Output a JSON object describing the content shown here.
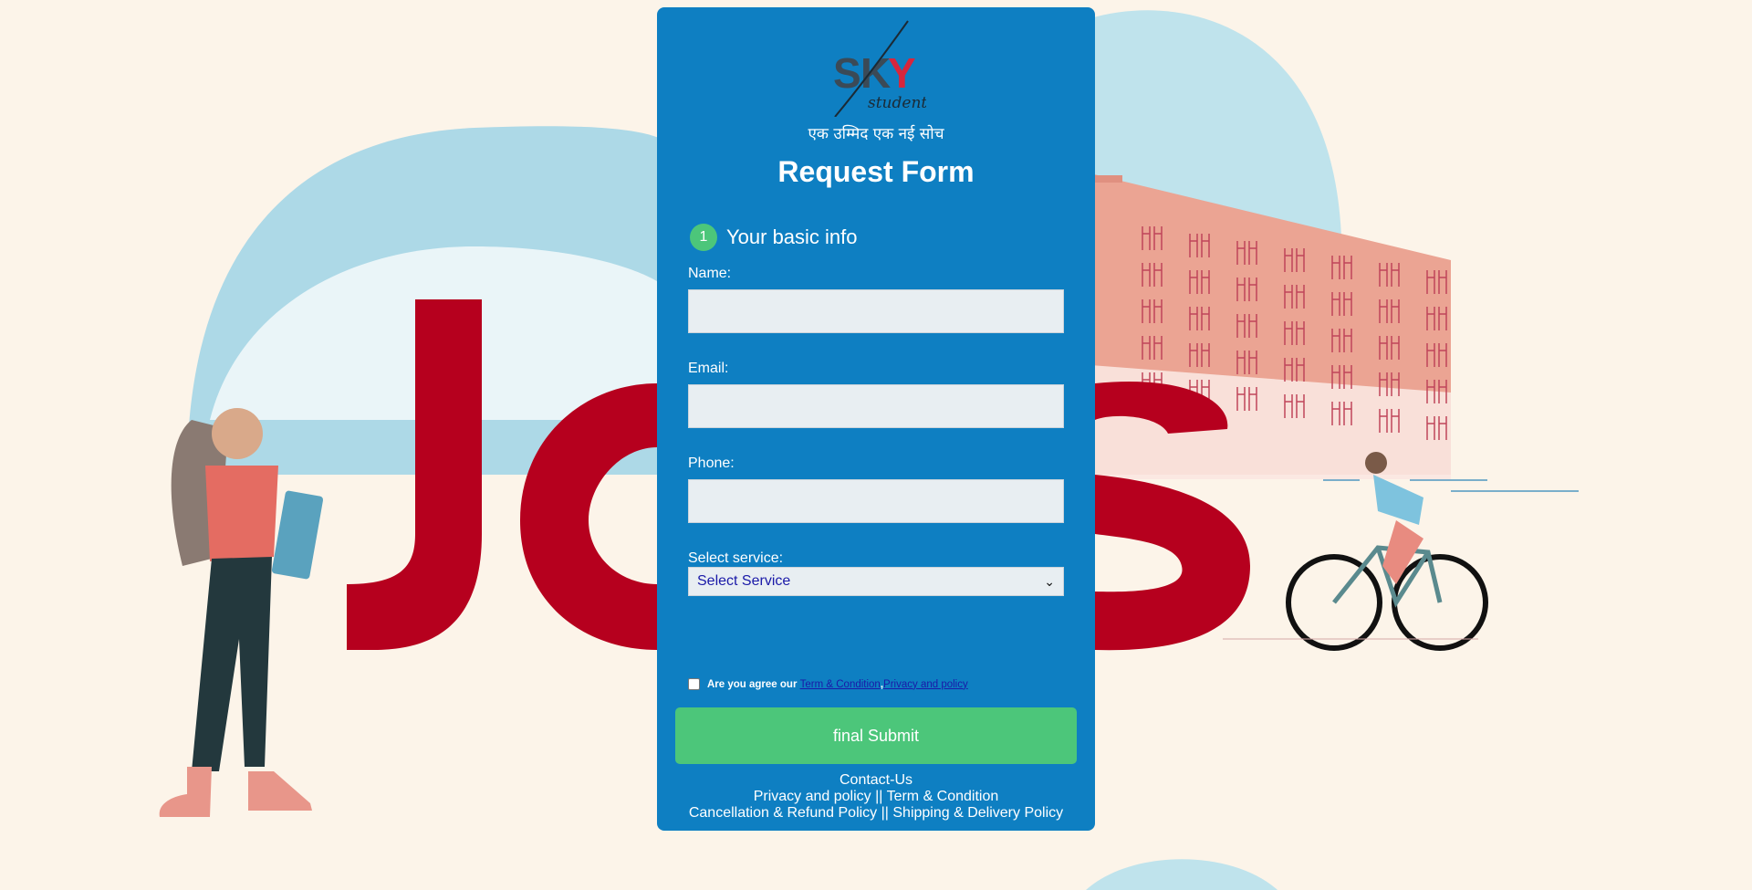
{
  "brand": {
    "tagline": "एक उम्मिद एक नई सोच"
  },
  "form": {
    "title": "Request Form",
    "step_number": "1",
    "step_label": "Your basic info",
    "fields": [
      {
        "label": "Name:",
        "value": "",
        "placeholder": ""
      },
      {
        "label": "Email:",
        "value": "",
        "placeholder": ""
      },
      {
        "label": "Phone:",
        "value": "",
        "placeholder": ""
      }
    ],
    "service": {
      "label": "Select service:",
      "selected": "Select Service"
    },
    "agreement": {
      "prefix": "Are you agree our",
      "terms_link": "Term & Condition",
      "separator": ",",
      "privacy_link": "Privacy and policy",
      "checked": false
    },
    "submit_label": "final Submit"
  },
  "footer": {
    "contact": "Contact-Us",
    "line2": "Privacy and policy || Term & Condition",
    "line3": "Cancellation & Refund Policy || Shipping & Delivery Policy"
  },
  "colors": {
    "page_background": "#fcf4e9",
    "card_background": "#0e7fc2",
    "accent_green": "#4cc67a",
    "jobs_red": "#b6001e",
    "link_blue": "#1a1aa8"
  },
  "background_art": {
    "headline": "JOBS"
  }
}
